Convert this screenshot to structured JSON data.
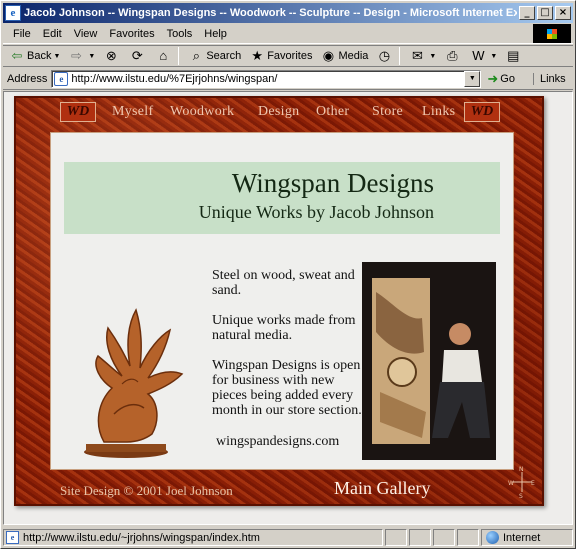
{
  "window": {
    "title": "Jacob Johnson -- Wingspan Designs -- Woodwork -- Sculpture -- Design - Microsoft Internet Exp...",
    "controls": {
      "minimize": "_",
      "maximize": "□",
      "close": "×"
    }
  },
  "menu": [
    "File",
    "Edit",
    "View",
    "Favorites",
    "Tools",
    "Help"
  ],
  "toolbar": {
    "back": "Back",
    "search": "Search",
    "favorites": "Favorites",
    "media": "Media"
  },
  "address": {
    "label": "Address",
    "url": "http://www.ilstu.edu/%7Ejrjohns/wingspan/",
    "go": "Go",
    "links": "Links"
  },
  "site": {
    "logo_text": "WD",
    "nav": [
      "Myself",
      "Woodwork",
      "Design",
      "Other",
      "Store",
      "Links"
    ],
    "heading": "Wingspan Designs",
    "subheading": "Unique Works by Jacob Johnson",
    "paragraphs": [
      "Steel on wood, sweat and sand.",
      "Unique works made from natural media.",
      "Wingspan Designs is open for business with new pieces being added every month in our store section."
    ],
    "site_name": "wingspandesigns.com",
    "credit": "Site Design © 2001 Joel Johnson",
    "gallery_link": "Main Gallery",
    "compass": {
      "n": "N",
      "s": "S",
      "e": "E",
      "w": "W"
    }
  },
  "status": {
    "url": "http://www.ilstu.edu/~jrjohns/wingspan/index.htm",
    "zone": "Internet"
  },
  "colors": {
    "titlebar": "#0a246a",
    "frame": "#952a0a",
    "banner": "#c8e0c8"
  }
}
